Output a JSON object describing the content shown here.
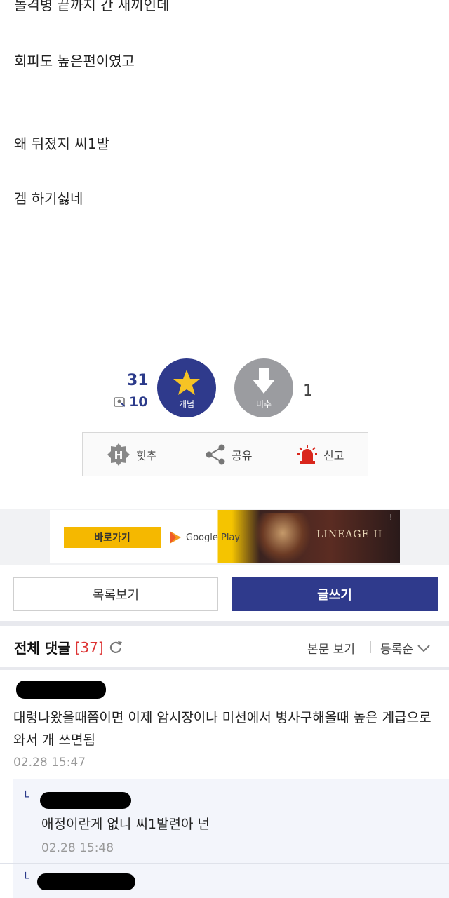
{
  "post": {
    "lines": [
      "돌격병 끝까지 간 새끼인데",
      "회피도 높은편이였고",
      "왜 뒤졌지 씨1발",
      "겜 하기싫네"
    ]
  },
  "votes": {
    "up_count": "31",
    "fixed_count": "10",
    "up_label": "개념",
    "down_label": "비추",
    "down_count": "1"
  },
  "actions": {
    "hit": "힛추",
    "share": "공유",
    "report": "신고"
  },
  "ad": {
    "cta": "바로가기",
    "store": "Google Play",
    "game": "LINEAGE II"
  },
  "buttons": {
    "list": "목록보기",
    "write": "글쓰기"
  },
  "comments_header": {
    "title": "전체 댓글",
    "count": "[37]",
    "view_body": "본문 보기",
    "sort": "등록순"
  },
  "comments": [
    {
      "text": "대령나왔을때쯤이면 이제 암시장이나 미션에서 병사구해올때 높은 계급으로 와서 개 쓰면됨",
      "time": "02.28 15:47"
    },
    {
      "text": "애정이란게 없니 씨1발련아 넌",
      "time": "02.28 15:48"
    }
  ],
  "colors": {
    "accent": "#2f3a8c",
    "muted": "#9b9ca0",
    "report": "#d9261c",
    "ad_button": "#f5b800"
  }
}
